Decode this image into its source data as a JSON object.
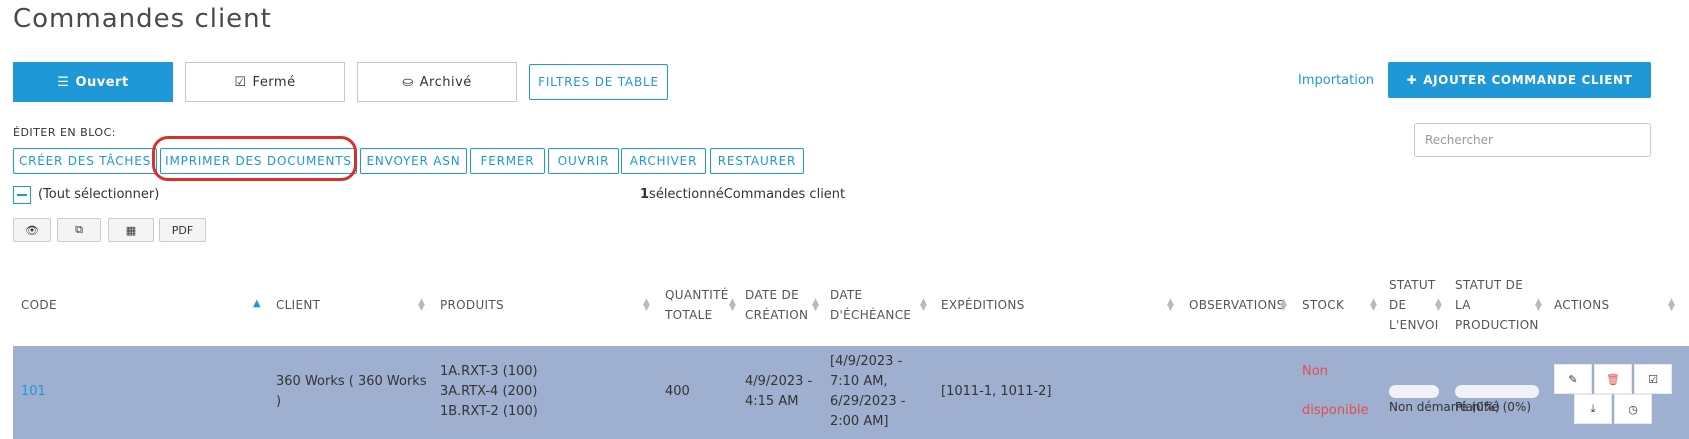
{
  "page": {
    "title": "Commandes client"
  },
  "tabs": [
    {
      "label": "Ouvert",
      "icon": "list-icon",
      "active": true
    },
    {
      "label": "Fermé",
      "icon": "check-square-icon",
      "active": false
    },
    {
      "label": "Archivé",
      "icon": "inbox-icon",
      "active": false
    }
  ],
  "toolbar": {
    "table_filters_label": "FILTRES DE TABLE",
    "import_label": "Importation",
    "add_label": "AJOUTER COMMANDE CLIENT",
    "add_icon": "plus-icon"
  },
  "bulk": {
    "label": "ÉDITER EN BLOC:",
    "actions": [
      "CRÉER DES TÂCHES",
      "IMPRIMER DES DOCUMENTS",
      "ENVOYER ASN",
      "FERMER",
      "OUVRIR",
      "ARCHIVER",
      "RESTAURER"
    ]
  },
  "search": {
    "placeholder": "Rechercher"
  },
  "selection": {
    "select_all_label": "(Tout sélectionner)",
    "count": "1",
    "count_text": "sélectionnéCommandes client"
  },
  "view_buttons": [
    {
      "icon": "eye-icon",
      "label": ""
    },
    {
      "icon": "copy-icon",
      "label": ""
    },
    {
      "icon": "table-icon",
      "label": ""
    },
    {
      "icon": "pdf",
      "label": "PDF"
    }
  ],
  "table": {
    "headers": {
      "code": "CODE",
      "client": "CLIENT",
      "produits": "PRODUITS",
      "quantite_1": "QUANTITÉ",
      "quantite_2": "TOTALE",
      "date_creation_1": "DATE DE",
      "date_creation_2": "CRÉATION",
      "date_echeance_1": "DATE",
      "date_echeance_2": "D'ÉCHÉANCE",
      "expeditions": "EXPÉDITIONS",
      "observations": "OBSERVATIONS",
      "stock": "STOCK",
      "statut_envoi_1": "STATUT",
      "statut_envoi_2": "DE",
      "statut_envoi_3": "L'ENVOI",
      "statut_prod_1": "STATUT DE",
      "statut_prod_2": "LA",
      "statut_prod_3": "PRODUCTION",
      "actions": "ACTIONS"
    },
    "rows": [
      {
        "code": "101",
        "client_1": "360 Works ( 360 Works",
        "client_2": ")",
        "produits_1": "1A.RXT-3 (100)",
        "produits_2": "3A.RTX-4 (200)",
        "produits_3": "1B.RXT-2 (100)",
        "quantite": "400",
        "date_creation_1": "4/9/2023 -",
        "date_creation_2": "4:15 AM",
        "date_echeance_1": "[4/9/2023 -",
        "date_echeance_2": "7:10 AM,",
        "date_echeance_3": "6/29/2023 -",
        "date_echeance_4": "2:00 AM]",
        "expeditions": "[1011-1, 1011-2]",
        "stock_1": "Non",
        "stock_2": "disponible",
        "statut_envoi": "Non démarré (0%)",
        "statut_prod": "Planifié (0%)"
      }
    ]
  },
  "colors": {
    "accent": "#1f98d8",
    "row_selected": "#9eafd0",
    "warning": "#e05050",
    "highlight_circle": "#d9302a"
  }
}
